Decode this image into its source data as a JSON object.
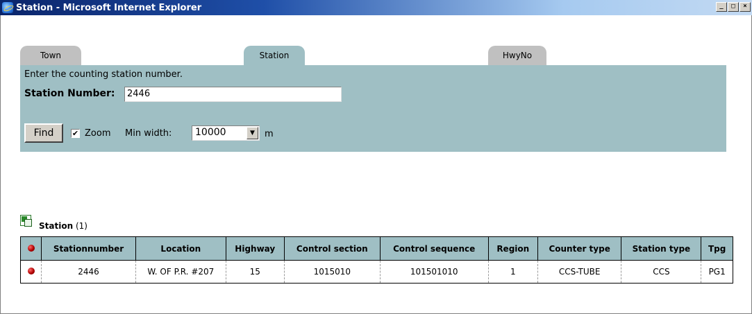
{
  "window": {
    "title": "Station - Microsoft Internet Explorer",
    "controls": {
      "minimize": "_",
      "maximize": "□",
      "close": "×"
    }
  },
  "tabs": [
    {
      "label": "Town",
      "active": false
    },
    {
      "label": "Station",
      "active": true
    },
    {
      "label": "HwyNo",
      "active": false
    }
  ],
  "form": {
    "instruction": "Enter the counting station number.",
    "station_label": "Station Number:",
    "station_value": "2446",
    "find_label": "Find",
    "zoom_checked": true,
    "zoom_label": "Zoom",
    "min_width_label": "Min width:",
    "min_width_value": "10000",
    "unit": "m"
  },
  "results": {
    "title": "Station",
    "count": "(1)",
    "columns": [
      "Stationnumber",
      "Location",
      "Highway",
      "Control section",
      "Control sequence",
      "Region",
      "Counter type",
      "Station type",
      "Tpg"
    ],
    "rows": [
      [
        "2446",
        "W. OF P.R. #207",
        "15",
        "1015010",
        "101501010",
        "1",
        "CCS-TUBE",
        "CCS",
        "PG1"
      ]
    ]
  },
  "colors": {
    "panel": "#9fbfc4",
    "tab_inactive": "#c0c0c0",
    "titlebar": "#0a246a"
  }
}
